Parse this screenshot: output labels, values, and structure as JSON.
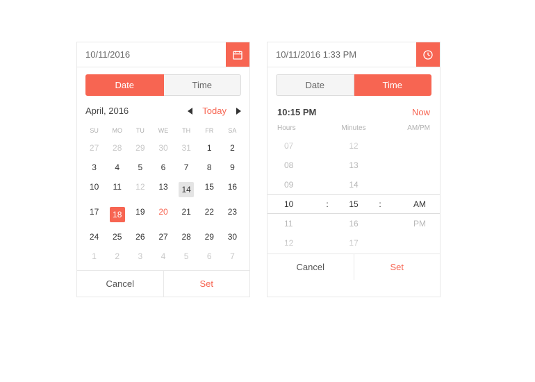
{
  "colors": {
    "accent": "#f76552"
  },
  "left": {
    "input": "10/11/2016",
    "tabs": {
      "date": "Date",
      "time": "Time",
      "active": "date"
    },
    "month": "April, 2016",
    "today": "Today",
    "dow": [
      "SU",
      "MO",
      "TU",
      "WE",
      "TH",
      "FR",
      "SA"
    ],
    "days": [
      {
        "n": 27,
        "other": true
      },
      {
        "n": 28,
        "other": true
      },
      {
        "n": 29,
        "other": true
      },
      {
        "n": 30,
        "other": true
      },
      {
        "n": 31,
        "other": true
      },
      {
        "n": 1
      },
      {
        "n": 2
      },
      {
        "n": 3
      },
      {
        "n": 4
      },
      {
        "n": 5
      },
      {
        "n": 6
      },
      {
        "n": 7
      },
      {
        "n": 8
      },
      {
        "n": 9
      },
      {
        "n": 10
      },
      {
        "n": 11
      },
      {
        "n": 12,
        "other": true
      },
      {
        "n": 13
      },
      {
        "n": 14,
        "hov": true
      },
      {
        "n": 15
      },
      {
        "n": 16
      },
      {
        "n": 17
      },
      {
        "n": 18,
        "sel": true
      },
      {
        "n": 19
      },
      {
        "n": 20,
        "red": true
      },
      {
        "n": 21
      },
      {
        "n": 22
      },
      {
        "n": 23
      },
      {
        "n": 24
      },
      {
        "n": 25
      },
      {
        "n": 26
      },
      {
        "n": 27
      },
      {
        "n": 28
      },
      {
        "n": 29
      },
      {
        "n": 30
      },
      {
        "n": 1,
        "other": true
      },
      {
        "n": 2,
        "other": true
      },
      {
        "n": 3,
        "other": true
      },
      {
        "n": 4,
        "other": true
      },
      {
        "n": 5,
        "other": true
      },
      {
        "n": 6,
        "other": true
      },
      {
        "n": 7,
        "other": true
      }
    ],
    "cancel": "Cancel",
    "set": "Set"
  },
  "right": {
    "input": "10/11/2016 1:33 PM",
    "tabs": {
      "date": "Date",
      "time": "Time",
      "active": "time"
    },
    "time": "10:15 PM",
    "now": "Now",
    "labels": {
      "hours": "Hours",
      "minutes": "Minutes",
      "ampm": "AM/PM"
    },
    "rows": [
      {
        "h": "07",
        "m": "12",
        "a": ""
      },
      {
        "h": "08",
        "m": "13",
        "a": ""
      },
      {
        "h": "09",
        "m": "14",
        "a": ""
      },
      {
        "h": "10",
        "m": "15",
        "a": "AM",
        "sel": true
      },
      {
        "h": "11",
        "m": "16",
        "a": "PM"
      },
      {
        "h": "12",
        "m": "17",
        "a": ""
      }
    ],
    "cancel": "Cancel",
    "set": "Set"
  }
}
